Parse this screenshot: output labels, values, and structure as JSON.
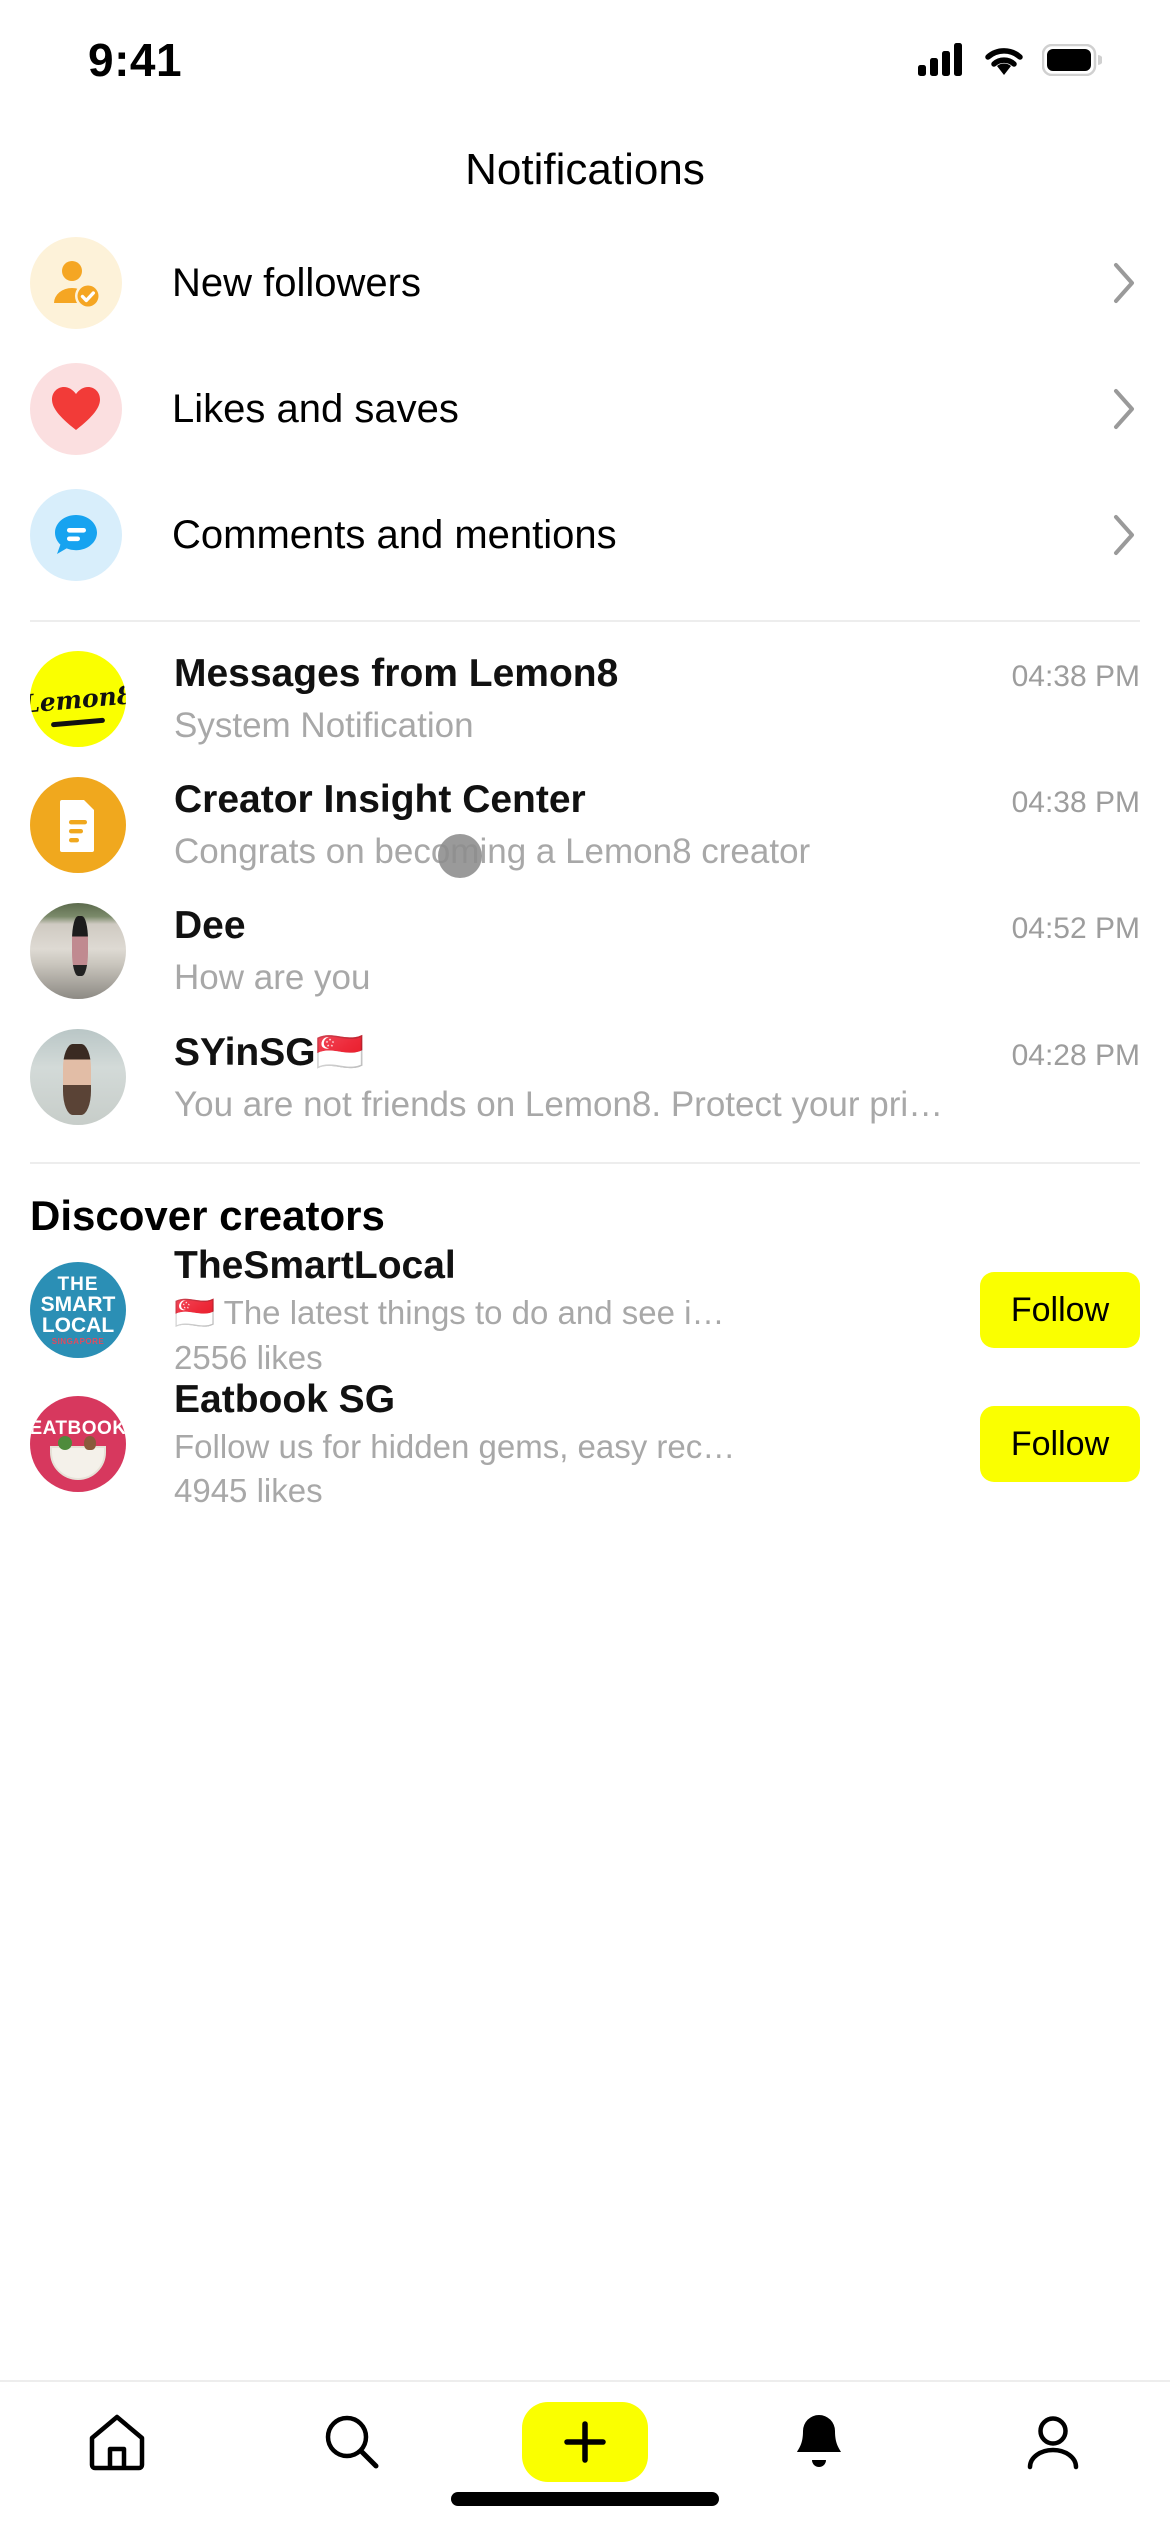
{
  "status_bar": {
    "time": "9:41",
    "cellular_icon": "signal-bars-icon",
    "wifi_icon": "wifi-icon",
    "battery_icon": "battery-icon"
  },
  "header": {
    "title": "Notifications"
  },
  "categories": [
    {
      "label": "New followers",
      "icon": "person-check-icon",
      "icon_color": "#F5A623",
      "bg_color": "#FDF2D9"
    },
    {
      "label": "Likes and saves",
      "icon": "heart-icon",
      "icon_color": "#F23B38",
      "bg_color": "#FBDFE0"
    },
    {
      "label": "Comments and mentions",
      "icon": "comment-bubble-icon",
      "icon_color": "#17A3F0",
      "bg_color": "#D8EEFB"
    }
  ],
  "chevron_icon": "chevron-right-icon",
  "messages": [
    {
      "name": "Messages from Lemon8",
      "subtitle": "System Notification",
      "time": "04:38 PM",
      "avatar": "lemon8-logo"
    },
    {
      "name": "Creator Insight Center",
      "subtitle": "Congrats on becoming a Lemon8 creator",
      "time": "04:38 PM",
      "avatar": "document-icon"
    },
    {
      "name": "Dee",
      "subtitle": "How are you",
      "time": "04:52 PM",
      "avatar": "photo-avatar-dee"
    },
    {
      "name": "SYinSG🇸🇬",
      "subtitle": "You are not friends on Lemon8. Protect your pri…",
      "time": "04:28 PM",
      "avatar": "photo-avatar-syinsg"
    }
  ],
  "discover": {
    "title": "Discover creators",
    "follow_label": "Follow",
    "creators": [
      {
        "name": "TheSmartLocal",
        "description": "🇸🇬 The latest things to do and see i…",
        "likes": "2556 likes",
        "avatar": "thesmartlocal-logo"
      },
      {
        "name": "Eatbook SG",
        "description": "Follow us for hidden gems, easy rec…",
        "likes": "4945 likes",
        "avatar": "eatbook-logo"
      }
    ]
  },
  "tabbar": {
    "items": [
      {
        "name": "home",
        "icon": "home-icon",
        "active": false
      },
      {
        "name": "search",
        "icon": "search-icon",
        "active": false
      },
      {
        "name": "create",
        "icon": "plus-icon",
        "active": false
      },
      {
        "name": "notifications",
        "icon": "bell-icon",
        "active": true
      },
      {
        "name": "profile",
        "icon": "person-icon",
        "active": false
      }
    ]
  },
  "colors": {
    "accent_yellow": "#FAFF00",
    "text_primary": "#111111",
    "text_muted": "#A8A8A8"
  }
}
